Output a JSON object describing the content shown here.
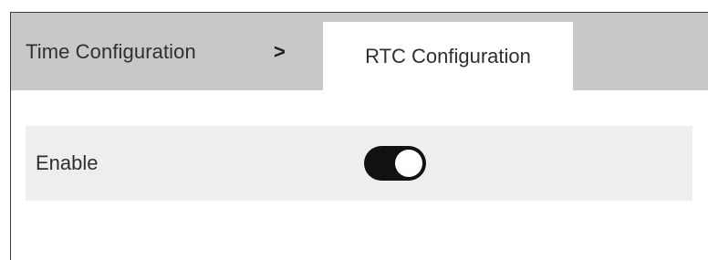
{
  "breadcrumb": {
    "parent_label": "Time Configuration",
    "separator": ">",
    "current_label": "RTC Configuration"
  },
  "settings": {
    "enable_label": "Enable",
    "enable_on": true
  },
  "colors": {
    "header_bg": "#c8c8c8",
    "row_bg": "#eeeeee",
    "toggle_on": "#111111"
  }
}
